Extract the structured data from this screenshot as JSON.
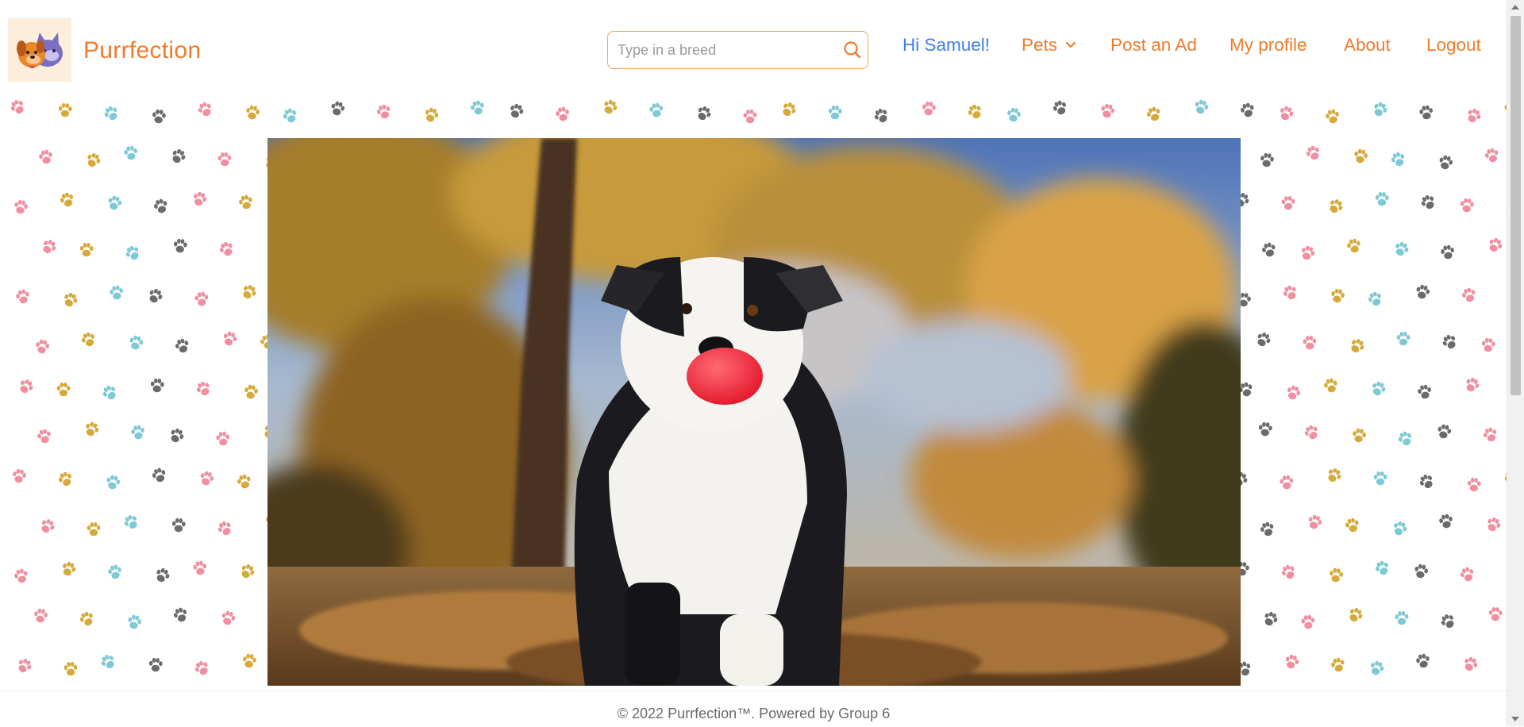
{
  "brand": {
    "name": "Purrfection",
    "logo_icon": "cat-and-dog-logo",
    "color": "#ef7b2d"
  },
  "search": {
    "placeholder": "Type in a breed",
    "value": "",
    "icon": "search-icon"
  },
  "nav": {
    "greeting": "Hi Samuel!",
    "items": [
      {
        "label": "Pets",
        "has_dropdown": true
      },
      {
        "label": "Post an Ad"
      },
      {
        "label": "My profile"
      },
      {
        "label": "About"
      },
      {
        "label": "Logout"
      }
    ]
  },
  "hero": {
    "image": "border-collie-with-red-ball-autumn-photo"
  },
  "background": {
    "pattern": "paw-print-pattern",
    "colors": [
      "#f08fa0",
      "#d6aa3a",
      "#7ec9d6",
      "#6b6b6b"
    ]
  },
  "footer": {
    "text": "© 2022 Purrfection™. Powered by Group 6"
  },
  "colors": {
    "accent": "#ef7b2d",
    "greeting": "#3f7ee8",
    "search_border": "#f0a35a",
    "logo_bg": "#fdeedb"
  }
}
